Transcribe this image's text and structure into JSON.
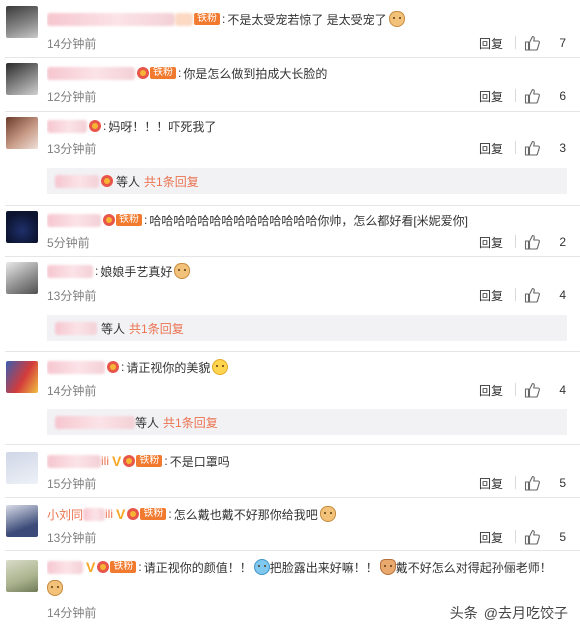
{
  "comments": [
    {
      "text": "不是太受宠若惊了 是太受宠了",
      "time": "14分钟前",
      "reply_label": "回复",
      "likes": "7",
      "fan_badge": "铁粉"
    },
    {
      "text": "你是怎么做到拍成大长脸的",
      "time": "12分钟前",
      "reply_label": "回复",
      "likes": "6",
      "fan_badge": "铁粉"
    },
    {
      "text": "妈呀！！！吓死我了",
      "time": "13分钟前",
      "reply_label": "回复",
      "likes": "3",
      "sub": {
        "tail": "等人",
        "more": "共1条回复"
      }
    },
    {
      "text": "哈哈哈哈哈哈哈哈哈哈哈哈哈哈你帅，怎么都好看[米妮爱你]",
      "time": "5分钟前",
      "reply_label": "回复",
      "likes": "2",
      "fan_badge": "铁粉"
    },
    {
      "text": "娘娘手艺真好",
      "time": "13分钟前",
      "reply_label": "回复",
      "likes": "4",
      "sub": {
        "tail": "等人",
        "more": "共1条回复"
      }
    },
    {
      "text": "请正视你的美貌",
      "time": "14分钟前",
      "reply_label": "回复",
      "likes": "4",
      "sub": {
        "tail": "等人",
        "more": "共1条回复"
      }
    },
    {
      "name_suffix": "ili",
      "text": "不是口罩吗",
      "time": "15分钟前",
      "reply_label": "回复",
      "likes": "5",
      "fan_badge": "铁粉"
    },
    {
      "name_prefix": "小刘同",
      "name_suffix": "ili",
      "text": "怎么戴也戴不好那你给我吧",
      "time": "13分钟前",
      "reply_label": "回复",
      "likes": "5",
      "fan_badge": "铁粉"
    },
    {
      "text_a": "请正视你的颜值！！",
      "text_b": "把脸露出来好嘛！！",
      "text_c": "戴不好怎么对得起孙俪老师！",
      "time": "14分钟前",
      "reply_label": "回复",
      "likes": "",
      "fan_badge": "铁粉"
    }
  ],
  "watermark": {
    "brand": "头条",
    "account": "@去月吃饺子"
  },
  "colors": {
    "accent": "#eb7350",
    "time": "#808080",
    "divider": "#e6e6e6",
    "sub_bg": "#f2f2f5"
  },
  "icons": {
    "like": "thumbs-up-icon",
    "fan": "fan-medal-icon",
    "vip": "vip-v-icon"
  }
}
